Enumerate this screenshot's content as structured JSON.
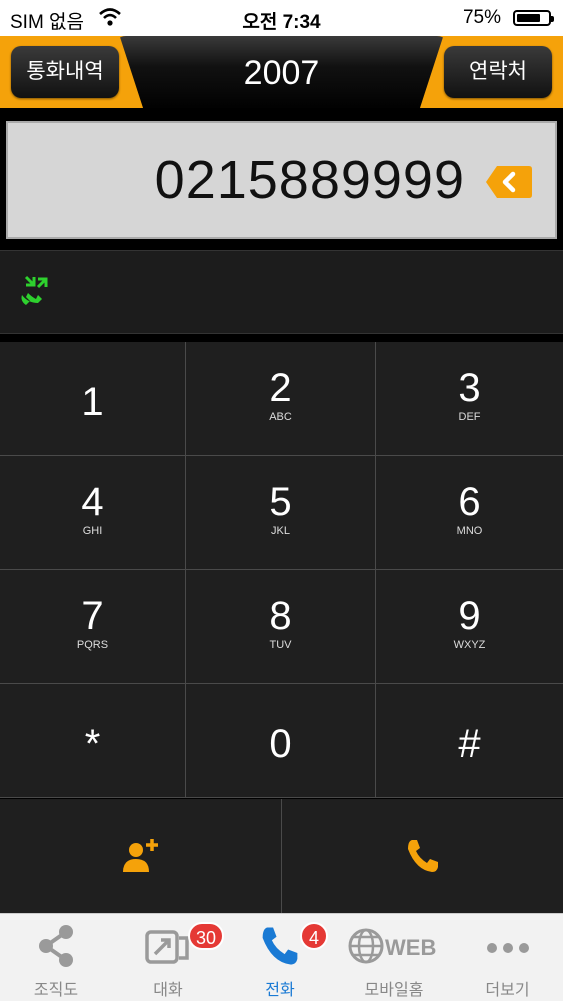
{
  "status": {
    "carrier": "SIM 없음",
    "time": "오전 7:34",
    "battery": "75%",
    "battery_level": 0.75
  },
  "header": {
    "left_button": "통화내역",
    "title": "2007",
    "right_button": "연락처"
  },
  "dial": {
    "number": "0215889999"
  },
  "keys": [
    {
      "digit": "1",
      "letters": ""
    },
    {
      "digit": "2",
      "letters": "ABC"
    },
    {
      "digit": "3",
      "letters": "DEF"
    },
    {
      "digit": "4",
      "letters": "GHI"
    },
    {
      "digit": "5",
      "letters": "JKL"
    },
    {
      "digit": "6",
      "letters": "MNO"
    },
    {
      "digit": "7",
      "letters": "PQRS"
    },
    {
      "digit": "8",
      "letters": "TUV"
    },
    {
      "digit": "9",
      "letters": "WXYZ"
    },
    {
      "digit": "*",
      "letters": ""
    },
    {
      "digit": "0",
      "letters": ""
    },
    {
      "digit": "#",
      "letters": ""
    }
  ],
  "actions": {
    "add_contact_icon": "add-contact-icon",
    "call_icon": "phone-icon"
  },
  "tabs": [
    {
      "label": "조직도",
      "icon": "share-icon",
      "badge": ""
    },
    {
      "label": "대화",
      "icon": "chat-icon",
      "badge": "30"
    },
    {
      "label": "전화",
      "icon": "phone-icon",
      "badge": "4"
    },
    {
      "label": "모바일홈",
      "icon": "globe-icon",
      "badge": "",
      "icon_text": "WEB"
    },
    {
      "label": "더보기",
      "icon": "more-icon",
      "badge": ""
    }
  ],
  "colors": {
    "accent": "#f5a20a",
    "active_tab": "#1a7ad4",
    "badge": "#e53935",
    "call_green": "#2ed12e"
  }
}
